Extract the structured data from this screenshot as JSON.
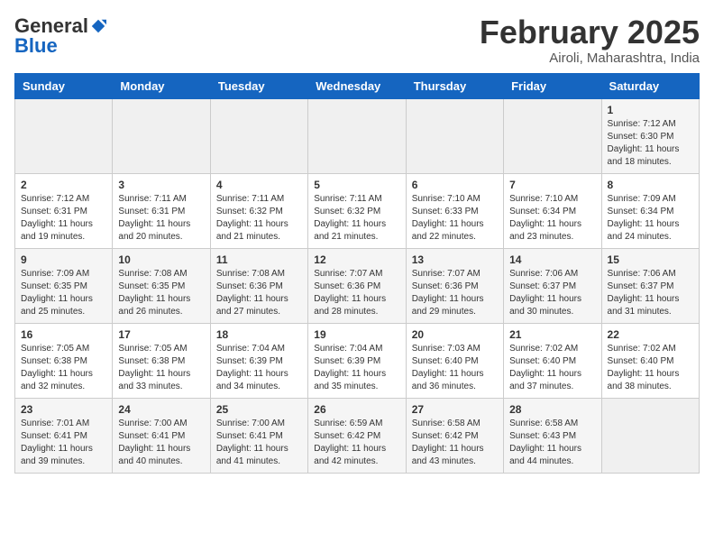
{
  "header": {
    "logo_general": "General",
    "logo_blue": "Blue",
    "month_title": "February 2025",
    "location": "Airoli, Maharashtra, India"
  },
  "days_of_week": [
    "Sunday",
    "Monday",
    "Tuesday",
    "Wednesday",
    "Thursday",
    "Friday",
    "Saturday"
  ],
  "weeks": [
    [
      {
        "day": "",
        "info": ""
      },
      {
        "day": "",
        "info": ""
      },
      {
        "day": "",
        "info": ""
      },
      {
        "day": "",
        "info": ""
      },
      {
        "day": "",
        "info": ""
      },
      {
        "day": "",
        "info": ""
      },
      {
        "day": "1",
        "info": "Sunrise: 7:12 AM\nSunset: 6:30 PM\nDaylight: 11 hours\nand 18 minutes."
      }
    ],
    [
      {
        "day": "2",
        "info": "Sunrise: 7:12 AM\nSunset: 6:31 PM\nDaylight: 11 hours\nand 19 minutes."
      },
      {
        "day": "3",
        "info": "Sunrise: 7:11 AM\nSunset: 6:31 PM\nDaylight: 11 hours\nand 20 minutes."
      },
      {
        "day": "4",
        "info": "Sunrise: 7:11 AM\nSunset: 6:32 PM\nDaylight: 11 hours\nand 21 minutes."
      },
      {
        "day": "5",
        "info": "Sunrise: 7:11 AM\nSunset: 6:32 PM\nDaylight: 11 hours\nand 21 minutes."
      },
      {
        "day": "6",
        "info": "Sunrise: 7:10 AM\nSunset: 6:33 PM\nDaylight: 11 hours\nand 22 minutes."
      },
      {
        "day": "7",
        "info": "Sunrise: 7:10 AM\nSunset: 6:34 PM\nDaylight: 11 hours\nand 23 minutes."
      },
      {
        "day": "8",
        "info": "Sunrise: 7:09 AM\nSunset: 6:34 PM\nDaylight: 11 hours\nand 24 minutes."
      }
    ],
    [
      {
        "day": "9",
        "info": "Sunrise: 7:09 AM\nSunset: 6:35 PM\nDaylight: 11 hours\nand 25 minutes."
      },
      {
        "day": "10",
        "info": "Sunrise: 7:08 AM\nSunset: 6:35 PM\nDaylight: 11 hours\nand 26 minutes."
      },
      {
        "day": "11",
        "info": "Sunrise: 7:08 AM\nSunset: 6:36 PM\nDaylight: 11 hours\nand 27 minutes."
      },
      {
        "day": "12",
        "info": "Sunrise: 7:07 AM\nSunset: 6:36 PM\nDaylight: 11 hours\nand 28 minutes."
      },
      {
        "day": "13",
        "info": "Sunrise: 7:07 AM\nSunset: 6:36 PM\nDaylight: 11 hours\nand 29 minutes."
      },
      {
        "day": "14",
        "info": "Sunrise: 7:06 AM\nSunset: 6:37 PM\nDaylight: 11 hours\nand 30 minutes."
      },
      {
        "day": "15",
        "info": "Sunrise: 7:06 AM\nSunset: 6:37 PM\nDaylight: 11 hours\nand 31 minutes."
      }
    ],
    [
      {
        "day": "16",
        "info": "Sunrise: 7:05 AM\nSunset: 6:38 PM\nDaylight: 11 hours\nand 32 minutes."
      },
      {
        "day": "17",
        "info": "Sunrise: 7:05 AM\nSunset: 6:38 PM\nDaylight: 11 hours\nand 33 minutes."
      },
      {
        "day": "18",
        "info": "Sunrise: 7:04 AM\nSunset: 6:39 PM\nDaylight: 11 hours\nand 34 minutes."
      },
      {
        "day": "19",
        "info": "Sunrise: 7:04 AM\nSunset: 6:39 PM\nDaylight: 11 hours\nand 35 minutes."
      },
      {
        "day": "20",
        "info": "Sunrise: 7:03 AM\nSunset: 6:40 PM\nDaylight: 11 hours\nand 36 minutes."
      },
      {
        "day": "21",
        "info": "Sunrise: 7:02 AM\nSunset: 6:40 PM\nDaylight: 11 hours\nand 37 minutes."
      },
      {
        "day": "22",
        "info": "Sunrise: 7:02 AM\nSunset: 6:40 PM\nDaylight: 11 hours\nand 38 minutes."
      }
    ],
    [
      {
        "day": "23",
        "info": "Sunrise: 7:01 AM\nSunset: 6:41 PM\nDaylight: 11 hours\nand 39 minutes."
      },
      {
        "day": "24",
        "info": "Sunrise: 7:00 AM\nSunset: 6:41 PM\nDaylight: 11 hours\nand 40 minutes."
      },
      {
        "day": "25",
        "info": "Sunrise: 7:00 AM\nSunset: 6:41 PM\nDaylight: 11 hours\nand 41 minutes."
      },
      {
        "day": "26",
        "info": "Sunrise: 6:59 AM\nSunset: 6:42 PM\nDaylight: 11 hours\nand 42 minutes."
      },
      {
        "day": "27",
        "info": "Sunrise: 6:58 AM\nSunset: 6:42 PM\nDaylight: 11 hours\nand 43 minutes."
      },
      {
        "day": "28",
        "info": "Sunrise: 6:58 AM\nSunset: 6:43 PM\nDaylight: 11 hours\nand 44 minutes."
      },
      {
        "day": "",
        "info": ""
      }
    ]
  ]
}
